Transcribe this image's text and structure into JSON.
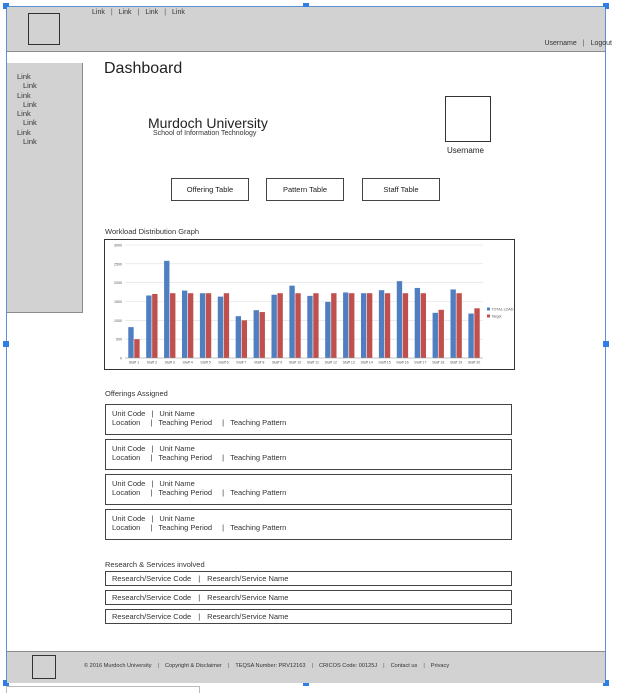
{
  "header": {
    "nav_links": [
      "Link",
      "Link",
      "Link",
      "Link"
    ],
    "username": "Username",
    "logout": "Logout"
  },
  "sidebar": {
    "items": [
      {
        "label": "Link",
        "indent": false
      },
      {
        "label": "Link",
        "indent": true
      },
      {
        "label": "Link",
        "indent": false
      },
      {
        "label": "Link",
        "indent": true
      },
      {
        "label": "Link",
        "indent": false
      },
      {
        "label": "Link",
        "indent": true
      },
      {
        "label": "Link",
        "indent": false
      },
      {
        "label": "Link",
        "indent": true
      }
    ]
  },
  "main": {
    "title": "Dashboard",
    "university": "Murdoch University",
    "school": "School of Information Technology",
    "avatar_label": "Username",
    "buttons": [
      "Offering Table",
      "Pattern Table",
      "Staff Table"
    ],
    "graph_heading": "Workload Distribution Graph",
    "offerings_heading": "Offerings Assigned",
    "offerings": [
      {
        "unit_code": "Unit Code",
        "unit_name": "Unit Name",
        "location": "Location",
        "period": "Teaching Period",
        "pattern": "Teaching Pattern"
      },
      {
        "unit_code": "Unit Code",
        "unit_name": "Unit Name",
        "location": "Location",
        "period": "Teaching Period",
        "pattern": "Teaching Pattern"
      },
      {
        "unit_code": "Unit Code",
        "unit_name": "Unit Name",
        "location": "Location",
        "period": "Teaching Period",
        "pattern": "Teaching Pattern"
      },
      {
        "unit_code": "Unit Code",
        "unit_name": "Unit Name",
        "location": "Location",
        "period": "Teaching Period",
        "pattern": "Teaching Pattern"
      }
    ],
    "research_heading": "Research & Services involved",
    "research": [
      {
        "code": "Research/Service Code",
        "name": "Research/Service Name"
      },
      {
        "code": "Research/Service Code",
        "name": "Research/Service Name"
      },
      {
        "code": "Research/Service Code",
        "name": "Research/Service Name"
      }
    ]
  },
  "footer": {
    "items": [
      "© 2016 Murdoch University",
      "Copyright & Disclaimer",
      "TEQSA Number: PRV12163",
      "CRICOS Code: 00125J",
      "Contact us",
      "Privacy"
    ]
  },
  "colors": {
    "total_load": "#4f7fc0",
    "target": "#c0504d",
    "chrome": "#d2d2d2"
  },
  "chart_data": {
    "type": "bar",
    "categories": [
      "Staff 1",
      "Staff 2",
      "Staff 3",
      "Staff 4",
      "Staff 5",
      "Staff 6",
      "Staff 7",
      "Staff 8",
      "Staff 9",
      "Staff 10",
      "Staff 11",
      "Staff 12",
      "Staff 13",
      "Staff 14",
      "Staff 15",
      "Staff 16",
      "Staff 17",
      "Staff 18",
      "Staff 19",
      "Staff 20"
    ],
    "series": [
      {
        "name": "TOTAL LOAD",
        "color": "#4f7fc0",
        "values": [
          820,
          1660,
          2580,
          1790,
          1720,
          1630,
          1110,
          1270,
          1680,
          1920,
          1650,
          1490,
          1740,
          1720,
          1800,
          2040,
          1860,
          1200,
          1820,
          1180
        ]
      },
      {
        "name": "Target",
        "color": "#c0504d",
        "values": [
          500,
          1700,
          1720,
          1720,
          1720,
          1720,
          1000,
          1220,
          1720,
          1720,
          1720,
          1720,
          1720,
          1720,
          1720,
          1720,
          1720,
          1280,
          1720,
          1320
        ]
      }
    ],
    "ylim": [
      0,
      3000
    ],
    "yticks": [
      "0",
      "500",
      "1000",
      "1500",
      "2000",
      "2500",
      "3000"
    ],
    "grid": true,
    "legend": "right"
  }
}
